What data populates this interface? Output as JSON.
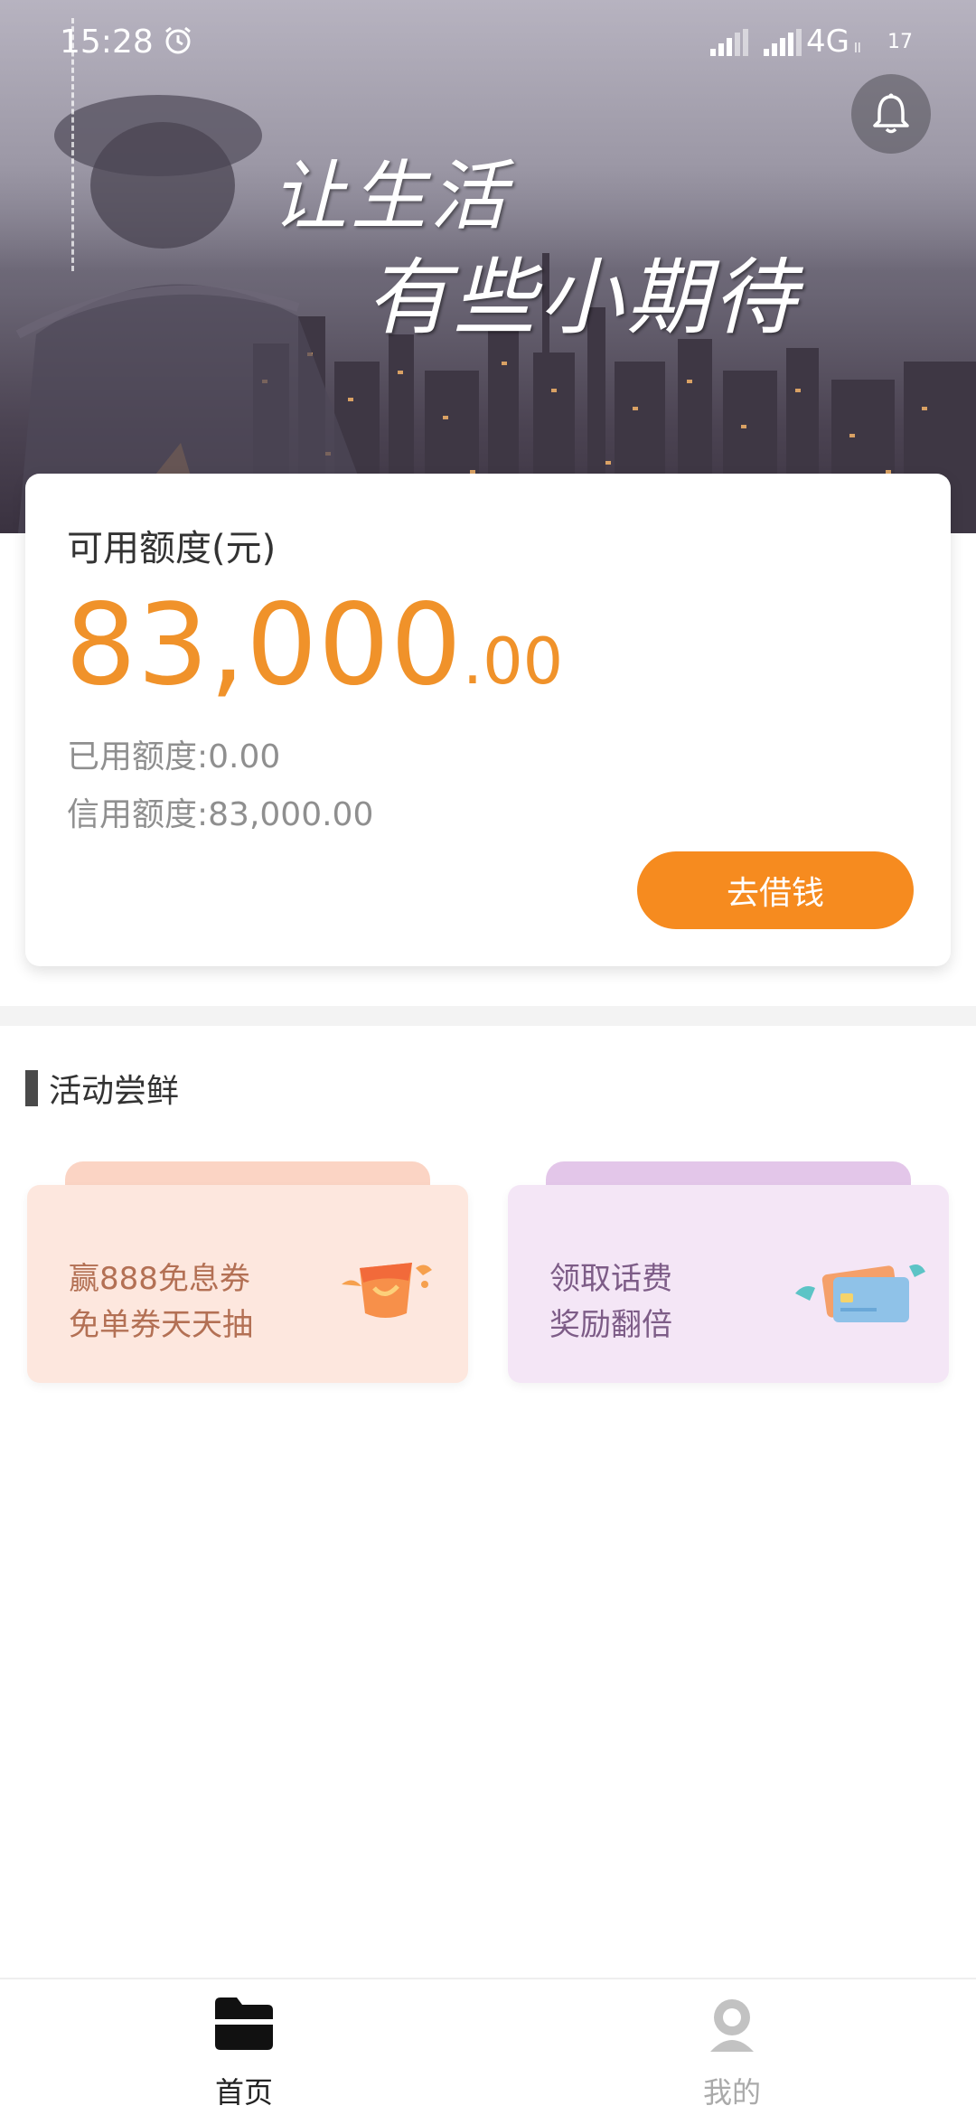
{
  "status_bar": {
    "time": "15:28",
    "network": "4G",
    "network_sub": "ll",
    "battery": "17"
  },
  "banner": {
    "slogan_line1": "让生活",
    "slogan_line2": "有些小期待"
  },
  "credit": {
    "available_label": "可用额度(元)",
    "available_int": "83,000",
    "available_dec": ".00",
    "used": "已用额度:0.00",
    "limit": "信用额度:83,000.00",
    "borrow_button": "去借钱"
  },
  "activity": {
    "title": "活动尝鲜",
    "cards": [
      {
        "line1": "赢888免息券",
        "line2": "免单券天天抽",
        "icon": "lucky-bag-icon"
      },
      {
        "line1": "领取话费",
        "line2": "奖励翻倍",
        "icon": "cards-icon"
      }
    ]
  },
  "nav": {
    "items": [
      {
        "label": "首页",
        "icon": "home-folder-icon"
      },
      {
        "label": "我的",
        "icon": "profile-icon"
      }
    ]
  },
  "colors": {
    "accent": "#f0922a",
    "button": "#f68b1f",
    "promo_a_bg": "#fde7de",
    "promo_b_bg": "#f4e6f6"
  }
}
